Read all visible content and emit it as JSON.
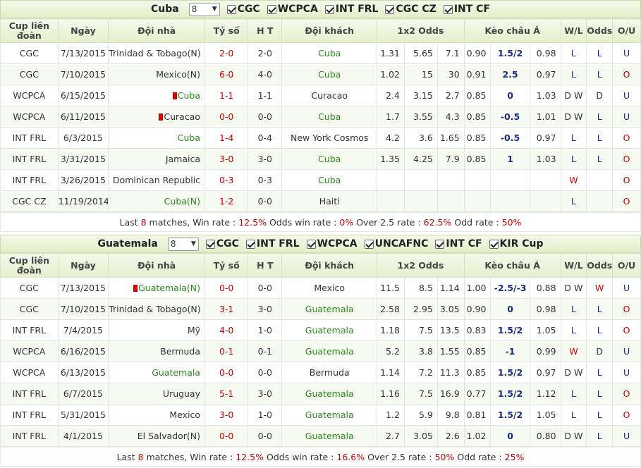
{
  "headers": {
    "league": "Cup liên đoàn",
    "date": "Ngày",
    "home": "Đội nhà",
    "score": "Tỷ số",
    "ht": "H T",
    "away": "Đội khách",
    "odds1x2": "1x2 Odds",
    "asian": "Kèo châu Á",
    "wl": "W/L",
    "odds": "Odds",
    "ou": "O/U"
  },
  "sections": [
    {
      "team": "Cuba",
      "count": "8",
      "filters": [
        "CGC",
        "WCPCA",
        "INT FRL",
        "CGC CZ",
        "INT CF"
      ],
      "rows": [
        {
          "league": "CGC",
          "date": "7/13/2015",
          "home": "Trinidad & Tobago(N)",
          "home_color": "",
          "home_rc": "",
          "score": "2-0",
          "ht": "2-0",
          "away": "Cuba",
          "away_color": "green",
          "o1": "1.31",
          "ox": "5.65",
          "o2": "7.1",
          "h1": "0.90",
          "hc": "1.5/2",
          "h2": "0.98",
          "wl": "L",
          "wl_color": "blue",
          "odds": "L",
          "odds_color": "blue",
          "ou": "U",
          "ou_color": "blue"
        },
        {
          "league": "CGC",
          "date": "7/10/2015",
          "home": "Mexico(N)",
          "home_color": "",
          "home_rc": "",
          "score": "6-0",
          "ht": "4-0",
          "away": "Cuba",
          "away_color": "green",
          "o1": "1.02",
          "ox": "15",
          "o2": "30",
          "h1": "0.91",
          "hc": "2.5",
          "h2": "0.97",
          "wl": "L",
          "wl_color": "blue",
          "odds": "L",
          "odds_color": "blue",
          "ou": "O",
          "ou_color": "red"
        },
        {
          "league": "WCPCA",
          "date": "6/15/2015",
          "home": "Cuba",
          "home_color": "green",
          "home_rc": "1",
          "score": "1-1",
          "ht": "1-1",
          "away": "Curacao",
          "away_color": "",
          "o1": "2.4",
          "ox": "3.15",
          "o2": "2.7",
          "h1": "0.85",
          "hc": "0",
          "h2": "1.03",
          "wl": "D W",
          "wl_color": "",
          "odds": "D",
          "odds_color": "",
          "ou": "U",
          "ou_color": "blue"
        },
        {
          "league": "WCPCA",
          "date": "6/11/2015",
          "home": "Curacao",
          "home_color": "",
          "home_rc": "1",
          "score": "0-0",
          "ht": "0-0",
          "away": "Cuba",
          "away_color": "green",
          "o1": "1.7",
          "ox": "3.55",
          "o2": "4.3",
          "h1": "0.85",
          "hc": "-0.5",
          "h2": "1.01",
          "wl": "D W",
          "wl_color": "",
          "odds": "L",
          "odds_color": "blue",
          "ou": "U",
          "ou_color": "blue"
        },
        {
          "league": "INT FRL",
          "date": "6/3/2015",
          "home": "Cuba",
          "home_color": "green",
          "home_rc": "",
          "score": "1-4",
          "ht": "0-4",
          "away": "New York Cosmos",
          "away_color": "",
          "o1": "4.2",
          "ox": "3.6",
          "o2": "1.65",
          "h1": "0.85",
          "hc": "-0.5",
          "h2": "0.97",
          "wl": "L",
          "wl_color": "blue",
          "odds": "L",
          "odds_color": "blue",
          "ou": "O",
          "ou_color": "red"
        },
        {
          "league": "INT FRL",
          "date": "3/31/2015",
          "home": "Jamaica",
          "home_color": "",
          "home_rc": "",
          "score": "3-0",
          "ht": "3-0",
          "away": "Cuba",
          "away_color": "green",
          "o1": "1.35",
          "ox": "4.25",
          "o2": "7.9",
          "h1": "0.85",
          "hc": "1",
          "h2": "1.03",
          "wl": "L",
          "wl_color": "blue",
          "odds": "L",
          "odds_color": "blue",
          "ou": "O",
          "ou_color": "red"
        },
        {
          "league": "INT FRL",
          "date": "3/26/2015",
          "home": "Dominican Republic",
          "home_color": "",
          "home_rc": "",
          "score": "0-3",
          "ht": "0-3",
          "away": "Cuba",
          "away_color": "green",
          "o1": "",
          "ox": "",
          "o2": "",
          "h1": "",
          "hc": "",
          "h2": "",
          "wl": "W",
          "wl_color": "red",
          "odds": "",
          "odds_color": "",
          "ou": "O",
          "ou_color": "red"
        },
        {
          "league": "CGC CZ",
          "date": "11/19/2014",
          "home": "Cuba(N)",
          "home_color": "green",
          "home_rc": "",
          "score": "1-2",
          "ht": "0-0",
          "away": "Haiti",
          "away_color": "",
          "o1": "",
          "ox": "",
          "o2": "",
          "h1": "",
          "hc": "",
          "h2": "",
          "wl": "L",
          "wl_color": "blue",
          "odds": "",
          "odds_color": "",
          "ou": "O",
          "ou_color": "red"
        }
      ],
      "summary": {
        "last_prefix": "Last",
        "last_count": "8",
        "matches_win_label": "matches, Win rate :",
        "win_rate": "12.5%",
        "odds_win_label": "Odds win rate :",
        "odds_win": "0%",
        "over_label": "Over 2.5 rate :",
        "over": "62.5%",
        "odd_label": "Odd rate :",
        "odd": "50%"
      }
    },
    {
      "team": "Guatemala",
      "count": "8",
      "filters": [
        "CGC",
        "INT FRL",
        "WCPCA",
        "UNCAFNC",
        "INT CF",
        "KIR Cup"
      ],
      "rows": [
        {
          "league": "CGC",
          "date": "7/13/2015",
          "home": "Guatemala(N)",
          "home_color": "green",
          "home_rc": "1",
          "score": "0-0",
          "ht": "0-0",
          "away": "Mexico",
          "away_color": "",
          "o1": "11.5",
          "ox": "8.5",
          "o2": "1.14",
          "h1": "1.00",
          "hc": "-2.5/-3",
          "h2": "0.88",
          "wl": "D W",
          "wl_color": "",
          "odds": "W",
          "odds_color": "red",
          "ou": "U",
          "ou_color": "blue"
        },
        {
          "league": "CGC",
          "date": "7/10/2015",
          "home": "Trinidad & Tobago(N)",
          "home_color": "",
          "home_rc": "",
          "score": "3-1",
          "ht": "3-0",
          "away": "Guatemala",
          "away_color": "green",
          "o1": "2.58",
          "ox": "2.95",
          "o2": "3.05",
          "h1": "0.90",
          "hc": "0",
          "h2": "0.98",
          "wl": "L",
          "wl_color": "blue",
          "odds": "L",
          "odds_color": "blue",
          "ou": "O",
          "ou_color": "red"
        },
        {
          "league": "INT FRL",
          "date": "7/4/2015",
          "home": "Mỹ",
          "home_color": "",
          "home_rc": "",
          "score": "4-0",
          "ht": "1-0",
          "away": "Guatemala",
          "away_color": "green",
          "o1": "1.18",
          "ox": "7.5",
          "o2": "13.5",
          "h1": "0.83",
          "hc": "1.5/2",
          "h2": "1.05",
          "wl": "L",
          "wl_color": "blue",
          "odds": "L",
          "odds_color": "blue",
          "ou": "O",
          "ou_color": "red"
        },
        {
          "league": "WCPCA",
          "date": "6/16/2015",
          "home": "Bermuda",
          "home_color": "",
          "home_rc": "",
          "score": "0-1",
          "ht": "0-1",
          "away": "Guatemala",
          "away_color": "green",
          "o1": "5.2",
          "ox": "3.8",
          "o2": "1.55",
          "h1": "0.85",
          "hc": "-1",
          "h2": "0.99",
          "wl": "W",
          "wl_color": "red",
          "odds": "D",
          "odds_color": "",
          "ou": "U",
          "ou_color": "blue"
        },
        {
          "league": "WCPCA",
          "date": "6/13/2015",
          "home": "Guatemala",
          "home_color": "green",
          "home_rc": "",
          "score": "0-0",
          "ht": "0-0",
          "away": "Bermuda",
          "away_color": "",
          "o1": "1.14",
          "ox": "7.2",
          "o2": "11.3",
          "h1": "0.85",
          "hc": "1.5/2",
          "h2": "0.97",
          "wl": "D W",
          "wl_color": "",
          "odds": "L",
          "odds_color": "blue",
          "ou": "U",
          "ou_color": "blue"
        },
        {
          "league": "INT FRL",
          "date": "6/7/2015",
          "home": "Uruguay",
          "home_color": "",
          "home_rc": "",
          "score": "5-1",
          "ht": "3-0",
          "away": "Guatemala",
          "away_color": "green",
          "o1": "1.16",
          "ox": "7.5",
          "o2": "16.9",
          "h1": "0.77",
          "hc": "1.5/2",
          "h2": "1.12",
          "wl": "L",
          "wl_color": "blue",
          "odds": "L",
          "odds_color": "blue",
          "ou": "O",
          "ou_color": "red"
        },
        {
          "league": "INT FRL",
          "date": "5/31/2015",
          "home": "Mexico",
          "home_color": "",
          "home_rc": "",
          "score": "3-0",
          "ht": "1-0",
          "away": "Guatemala",
          "away_color": "green",
          "o1": "1.2",
          "ox": "5.9",
          "o2": "9.8",
          "h1": "0.81",
          "hc": "1.5/2",
          "h2": "1.05",
          "wl": "L",
          "wl_color": "blue",
          "odds": "L",
          "odds_color": "blue",
          "ou": "O",
          "ou_color": "red"
        },
        {
          "league": "INT FRL",
          "date": "4/1/2015",
          "home": "El Salvador(N)",
          "home_color": "",
          "home_rc": "",
          "score": "0-0",
          "ht": "0-0",
          "away": "Guatemala",
          "away_color": "green",
          "o1": "2.7",
          "ox": "3.05",
          "o2": "2.6",
          "h1": "1.02",
          "hc": "0",
          "h2": "0.80",
          "wl": "D W",
          "wl_color": "",
          "odds": "L",
          "odds_color": "blue",
          "ou": "U",
          "ou_color": "blue"
        }
      ],
      "summary": {
        "last_prefix": "Last",
        "last_count": "8",
        "matches_win_label": "matches, Win rate :",
        "win_rate": "12.5%",
        "odds_win_label": "Odds win rate :",
        "odds_win": "16.6%",
        "over_label": "Over 2.5 rate :",
        "over": "50%",
        "odd_label": "Odd rate :",
        "odd": "25%"
      }
    }
  ]
}
